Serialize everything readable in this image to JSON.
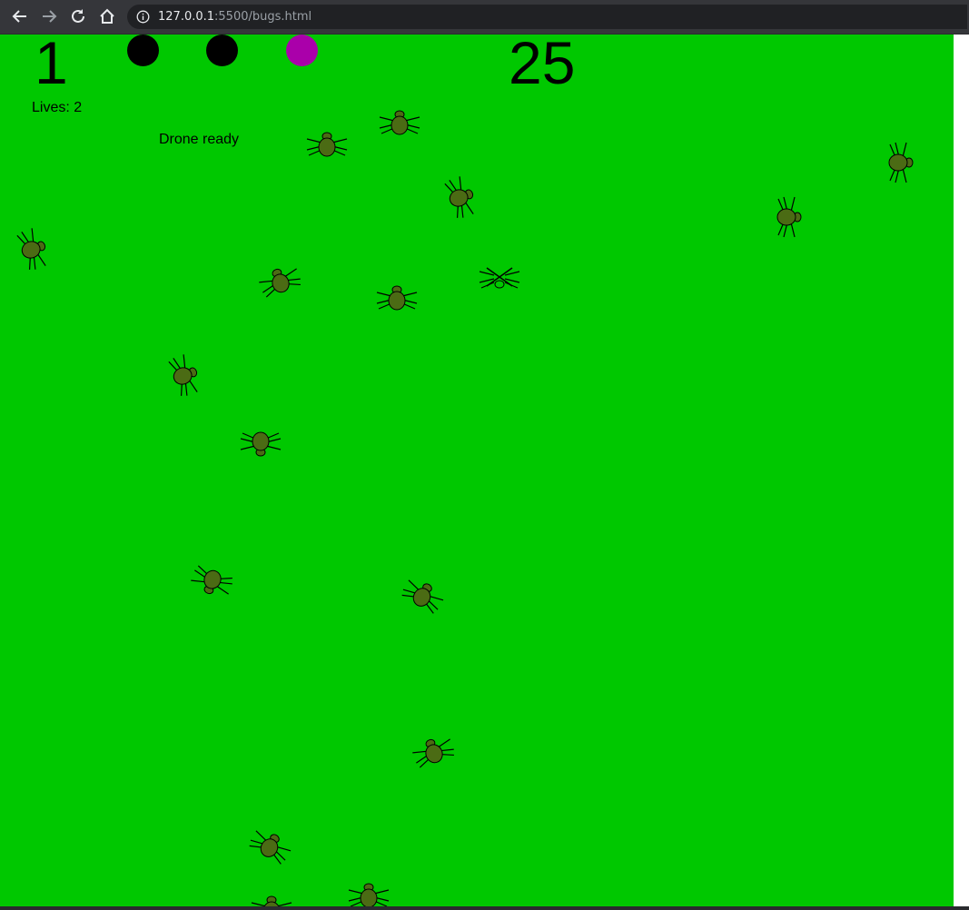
{
  "browser": {
    "url_host": "127.0.0.1",
    "url_rest": ":5500/bugs.html"
  },
  "hud": {
    "level": "1",
    "score": "25",
    "lives_label": "Lives: 2",
    "drone_status": "Drone ready"
  },
  "ammo": [
    {
      "color": "#000000"
    },
    {
      "color": "#000000"
    },
    {
      "color": "#aa00aa"
    }
  ],
  "colors": {
    "field": "#00c800",
    "bug_body": "#4b6b14",
    "bug_outline": "#000000"
  },
  "bugs": [
    {
      "id": "bug-01",
      "state": "alive"
    },
    {
      "id": "bug-02",
      "state": "alive"
    },
    {
      "id": "bug-03",
      "state": "alive"
    },
    {
      "id": "bug-04",
      "state": "alive"
    },
    {
      "id": "bug-05",
      "state": "alive"
    },
    {
      "id": "bug-06",
      "state": "alive"
    },
    {
      "id": "bug-07",
      "state": "alive"
    },
    {
      "id": "bug-08",
      "state": "squashed"
    },
    {
      "id": "bug-09",
      "state": "alive"
    },
    {
      "id": "bug-10",
      "state": "alive"
    },
    {
      "id": "bug-11",
      "state": "alive"
    },
    {
      "id": "bug-12",
      "state": "alive"
    },
    {
      "id": "bug-13",
      "state": "alive"
    },
    {
      "id": "bug-14",
      "state": "alive"
    },
    {
      "id": "bug-15",
      "state": "alive"
    },
    {
      "id": "bug-16",
      "state": "alive"
    },
    {
      "id": "bug-17",
      "state": "alive"
    },
    {
      "id": "bug-18",
      "state": "alive"
    }
  ]
}
